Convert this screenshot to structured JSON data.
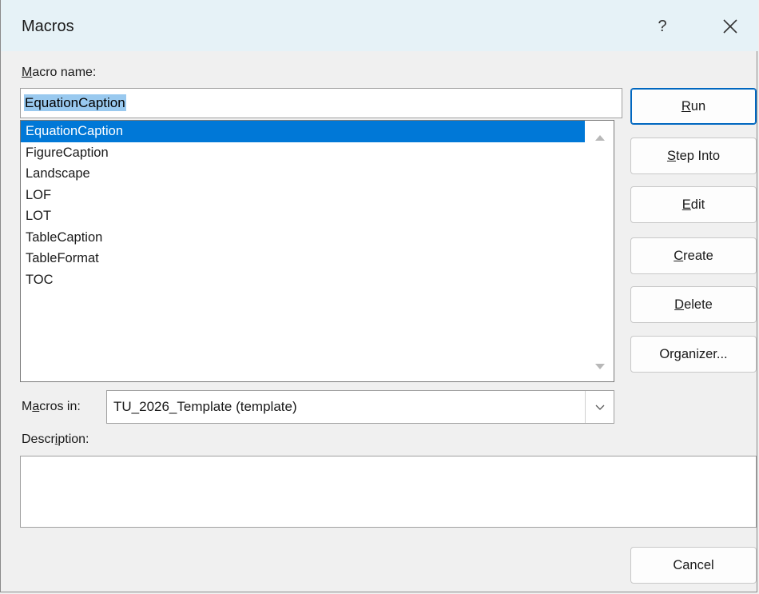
{
  "window": {
    "title": "Macros",
    "help_label": "?",
    "close_icon": "close-icon"
  },
  "macro_name": {
    "label_mnemonic": "M",
    "label_rest": "acro name:",
    "value": "EquationCaption"
  },
  "macro_list": {
    "selected_index": 0,
    "items": [
      "EquationCaption",
      "FigureCaption",
      "Landscape",
      "LOF",
      "LOT",
      "TableCaption",
      "TableFormat",
      "TOC"
    ]
  },
  "buttons": {
    "run": {
      "pre": "",
      "mnemonic": "R",
      "post": "un"
    },
    "step_into": {
      "pre": "",
      "mnemonic": "S",
      "post": "tep Into"
    },
    "edit": {
      "pre": "",
      "mnemonic": "E",
      "post": "dit"
    },
    "create": {
      "pre": "",
      "mnemonic": "C",
      "post": "reate"
    },
    "delete": {
      "pre": "",
      "mnemonic": "D",
      "post": "elete"
    },
    "organizer": {
      "pre": "Or",
      "mnemonic": "g",
      "post": "anizer..."
    },
    "cancel": "Cancel"
  },
  "macros_in": {
    "label_pre": "M",
    "label_mnemonic": "a",
    "label_post": "cros in:",
    "value": "TU_2026_Template (template)"
  },
  "description": {
    "label_pre": "Descr",
    "label_mnemonic": "i",
    "label_post": "ption:",
    "value": ""
  },
  "colors": {
    "titlebar": "#e6f2f7",
    "selection": "#0078d7",
    "text_selection": "#99c9ef",
    "default_button_border": "#0067c0"
  }
}
